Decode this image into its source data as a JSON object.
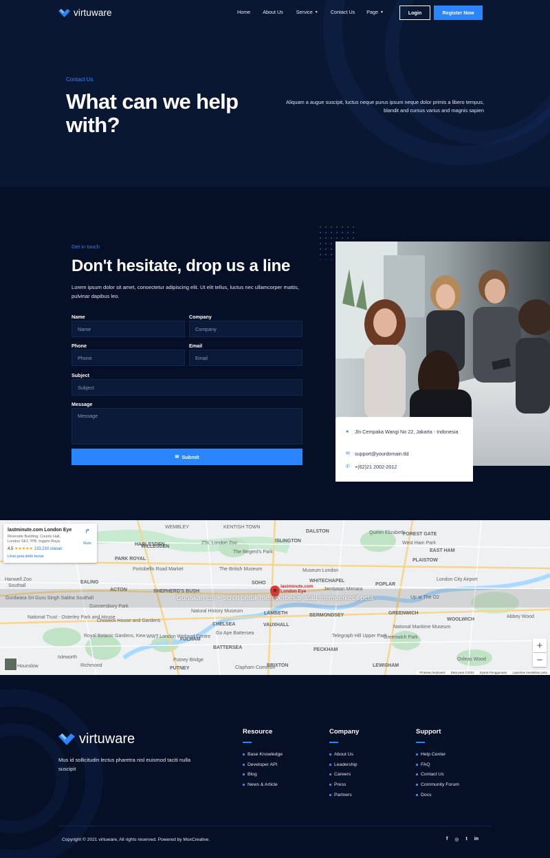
{
  "nav": {
    "brand": "virtuware",
    "items": [
      {
        "label": "Home"
      },
      {
        "label": "About Us"
      },
      {
        "label": "Service",
        "has_dropdown": true
      },
      {
        "label": "Contact Us"
      },
      {
        "label": "Page",
        "has_dropdown": true
      }
    ],
    "login_label": "Login",
    "register_label": "Register Now"
  },
  "hero": {
    "eyebrow": "Contact Us",
    "title": "What can we help with?",
    "description": "Aliquam a augue suscipit, luctus neque purus ipsum neque dolor primis a libero tempus, blandit and cursus varius and magnis sapien"
  },
  "contact": {
    "eyebrow": "Get in touch",
    "title": "Don't hesitate, drop us a line",
    "description": "Lorem ipsum dolor sit amet, consectetur adipiscing elit. Ut elit tellus, luctus nec ullamcorper mattis, pulvinar dapibus leo.",
    "form": {
      "name_label": "Name",
      "name_placeholder": "Name",
      "company_label": "Company",
      "company_placeholder": "Company",
      "phone_label": "Phone",
      "phone_placeholder": "Phone",
      "email_label": "Email",
      "email_placeholder": "Email",
      "subject_label": "Subject",
      "subject_placeholder": "Subject",
      "message_label": "Message",
      "message_placeholder": "Message",
      "submit_label": "Submit"
    },
    "info": {
      "address": "Jln Cempaka Wangi No 22, Jakarta - Indonesia",
      "email": "support@yourdomain.tld",
      "phone": "+(62)21 2002-2012"
    }
  },
  "map": {
    "place_name": "lastminute.com London Eye",
    "place_address": "Riverside Building, County Hall, London SE1 7PB, Inggris Raya",
    "rating": "4,5",
    "review_count": "133.210 ulasan",
    "route_label": "Rute",
    "larger_map_link": "Lihat peta lebih besar",
    "scroll_hint": "Gunakan ctrl + scroll untuk memperbesar atau memperkecil peta",
    "marker_label": "lastminute.com London Eye",
    "zoom_in": "+",
    "zoom_out": "−",
    "attribution": [
      "Pintasan keyboard",
      "Data peta ©2022",
      "Syarat Penggunaan",
      "Laporkan kesalahan peta"
    ],
    "place_labels": [
      "WEMBLEY",
      "WILLESDEN",
      "KENTISH TOWN",
      "DALSTON",
      "Queen Elizabeth Olympic Park",
      "FOREST GATE",
      "ISLINGTON",
      "HARLESDEN",
      "ZSL London Zoo",
      "West Ham Park",
      "EAST HAM",
      "PARK ROYAL",
      "The Regent's Park",
      "Portobello Road Market",
      "The British Museum",
      "SOHO",
      "Museum London",
      "PLAISTOW",
      "Hanwell Zoo",
      "Southall",
      "EALING",
      "ACTON",
      "SHEPHERD'S BUSH",
      "WHITECHAPEL",
      "Jembatan Menara",
      "POPLAR",
      "London City Airport",
      "Up at The O2",
      "Gurdwara Sri Guru Singh Sabha Southall",
      "Gunnersbury Park",
      "Natural History Museum",
      "LAMBETH",
      "BERMONDSEY",
      "GREENWICH",
      "WOOLWICH",
      "National Trust - Osterley Park and House",
      "Chiswick House and Gardens",
      "CHELSEA",
      "VAUXHALL",
      "Royal Botanic Gardens, Kew",
      "WWT London Wetland Centre",
      "FULHAM",
      "Go Ape Battersea",
      "BATTERSEA",
      "Telegraph Hill Upper Park",
      "Greenwich Park",
      "National Maritime Museum",
      "Oxleas Wood",
      "Abbey Wood",
      "PECKHAM",
      "Putney Bridge",
      "Isleworth",
      "Richmond",
      "PUTNEY",
      "Clapham Common",
      "BRIXTON",
      "LEWISHAM",
      "Hounslow"
    ]
  },
  "footer": {
    "brand": "virtuware",
    "description": "Mus id sollicitudin lectus pharetra nisl euismod taciti nulla suscipit",
    "columns": [
      {
        "title": "Resource",
        "links": [
          "Base Knowledge",
          "Developer API",
          "Blog",
          "News & Article"
        ]
      },
      {
        "title": "Company",
        "links": [
          "About Us",
          "Leadership",
          "Careers",
          "Press",
          "Partners"
        ]
      },
      {
        "title": "Support",
        "links": [
          "Help Center",
          "FAQ",
          "Contact Us",
          "Community Forum",
          "Docs"
        ]
      }
    ],
    "copyright": "Copyright © 2021 virtuware, All rights reserved. Powered by MoxCreative.",
    "social": [
      "f",
      "◎",
      "t",
      "in"
    ],
    "social_icons": [
      "facebook-icon",
      "instagram-icon",
      "twitter-icon",
      "linkedin-icon"
    ]
  },
  "colors": {
    "accent": "#2a85ff",
    "background": "#050f26",
    "hero_bg": "#0a1733",
    "field_bg": "#0b1a38"
  }
}
